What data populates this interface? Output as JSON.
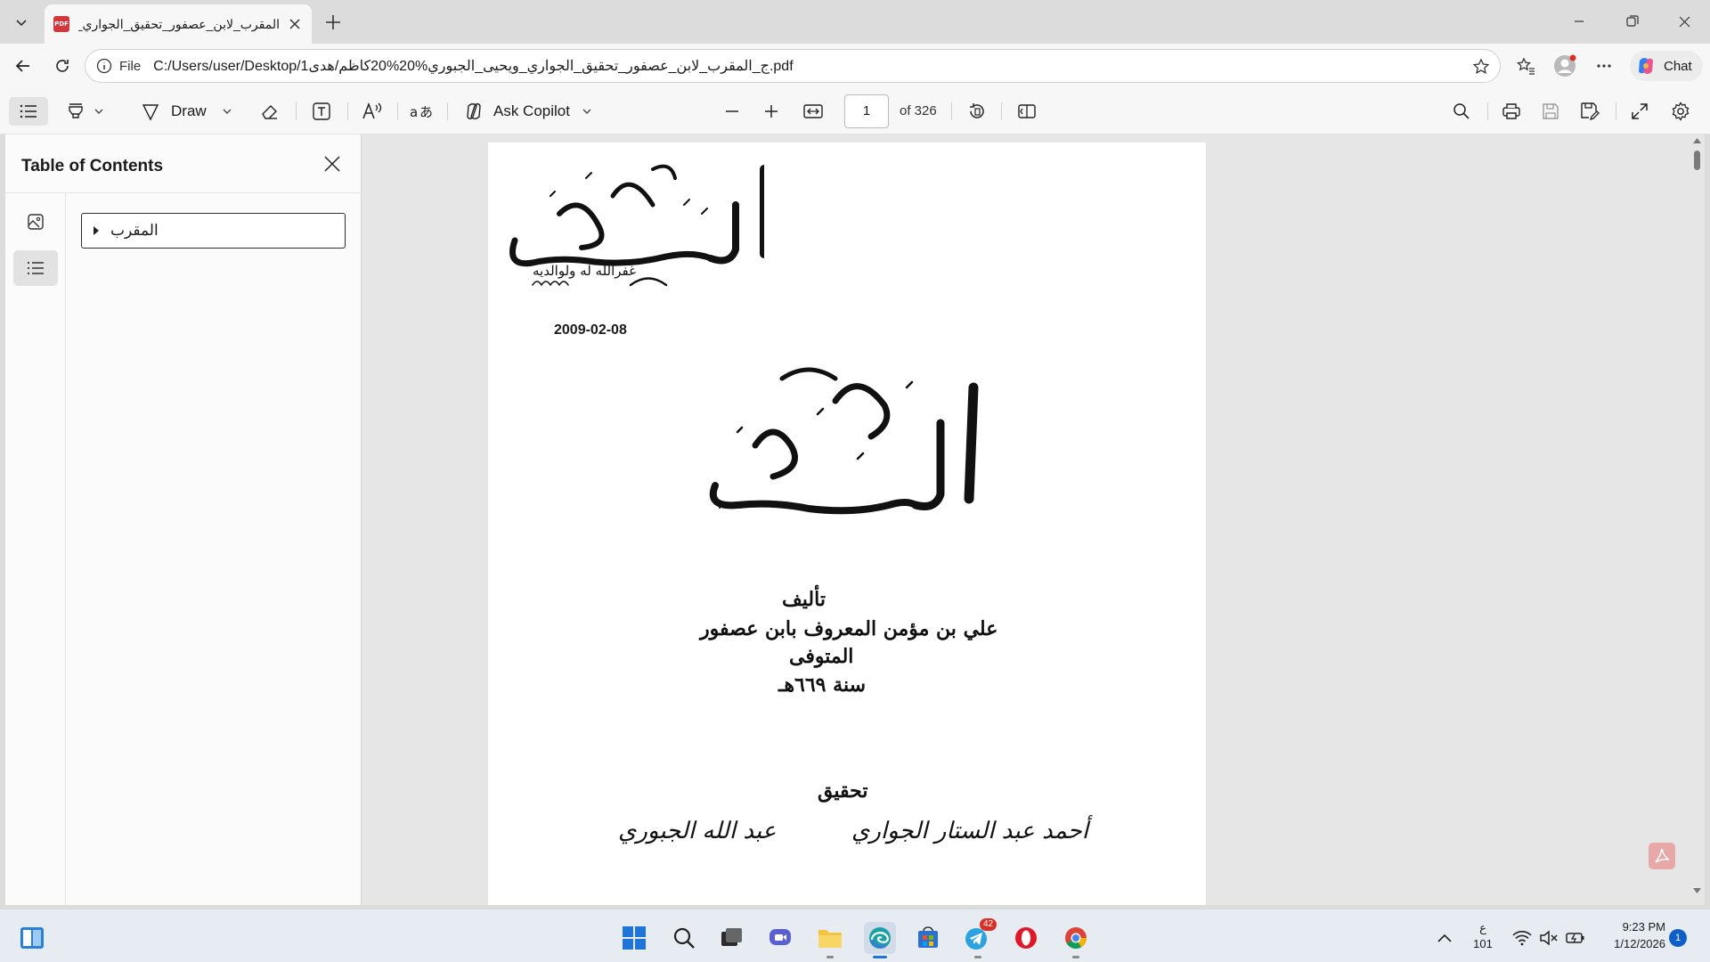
{
  "browser": {
    "tab_title": "المقرب_لابن_عصفور_تحقيق_الجواري_",
    "tab_favicon_text": "PDF",
    "address": {
      "scheme_label": "File",
      "url": "C:/Users/user/Desktop/1ج_المقرب_لابن_عصفور_تحقيق_الجواري_ويحيى_الجبوري%20%20كاظم/هدى.pdf"
    },
    "chat_label": "Chat"
  },
  "pdf_toolbar": {
    "draw_label": "Draw",
    "ask_copilot_label": "Ask Copilot",
    "page_number": "1",
    "page_total": "of 326"
  },
  "sidebar": {
    "title": "Table of Contents",
    "toc_items": [
      {
        "label": "المقرب"
      }
    ]
  },
  "document": {
    "stamp_title": "المسهم",
    "stamp_small_caption": "غفرالله له ولوالديه",
    "stamp_date": "2009-02-08",
    "book_title": "المقرب",
    "author_lines": [
      "تأليف",
      "علي بن مؤمن المعروف بابن عصفور",
      "المتوفى",
      "سنة ٦٦٩هـ"
    ],
    "editor_heading": "تحقيق",
    "editors": [
      "أحمد عبد الستار الجواري",
      "عبد الله الجبوري"
    ]
  },
  "taskbar": {
    "telegram_badge": "42",
    "tray_keyboard_line1": "ع",
    "tray_keyboard_line2": "101",
    "time": "9:23 PM",
    "date": "1/12/2026",
    "notification_count": "1"
  },
  "colors": {
    "accent": "#0f5fc9",
    "pdf_red": "#d4373b",
    "page_bg": "#ffffff",
    "chrome_bg": "#f7f7f7"
  }
}
